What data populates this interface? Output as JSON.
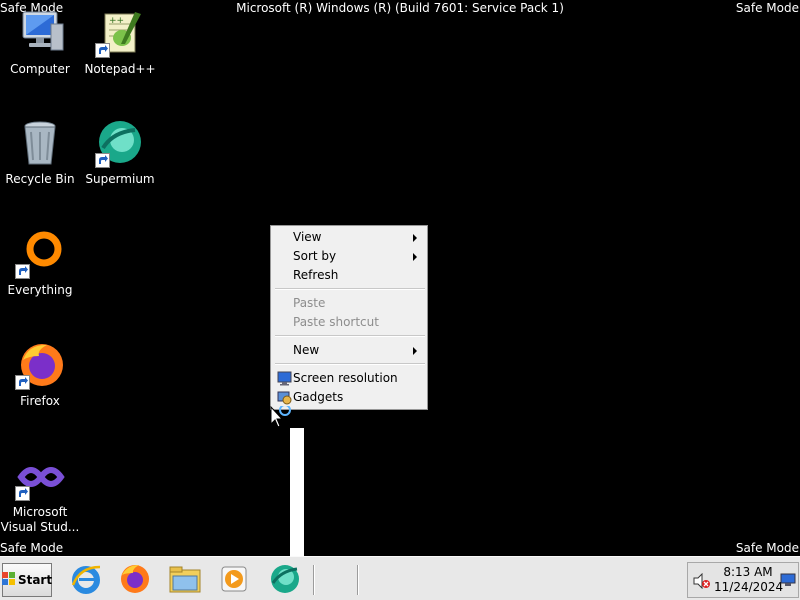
{
  "screen": {
    "safe_mode_label": "Safe Mode",
    "title": "Microsoft (R) Windows (R) (Build 7601: Service Pack 1)"
  },
  "desktop_icons": [
    {
      "label": "Computer"
    },
    {
      "label": "Notepad++"
    },
    {
      "label": "Recycle Bin"
    },
    {
      "label": "Supermium"
    },
    {
      "label": "Everything"
    },
    {
      "label": "Firefox"
    },
    {
      "label": "Microsoft Visual Stud..."
    }
  ],
  "context_menu": {
    "view": "View",
    "sort_by": "Sort by",
    "refresh": "Refresh",
    "paste": "Paste",
    "paste_shortcut": "Paste shortcut",
    "new": "New",
    "screen_resolution": "Screen resolution",
    "gadgets": "Gadgets"
  },
  "taskbar": {
    "start_label": "Start",
    "pinned": [
      "internet-explorer-icon",
      "firefox-icon",
      "file-explorer-icon",
      "media-player-icon",
      "supermium-icon"
    ],
    "time": "8:13 AM",
    "date": "11/24/2024"
  },
  "colors": {
    "desktop": "#000000",
    "menu_bg": "#f0f0f0",
    "taskbar": "#e8e8e8"
  }
}
